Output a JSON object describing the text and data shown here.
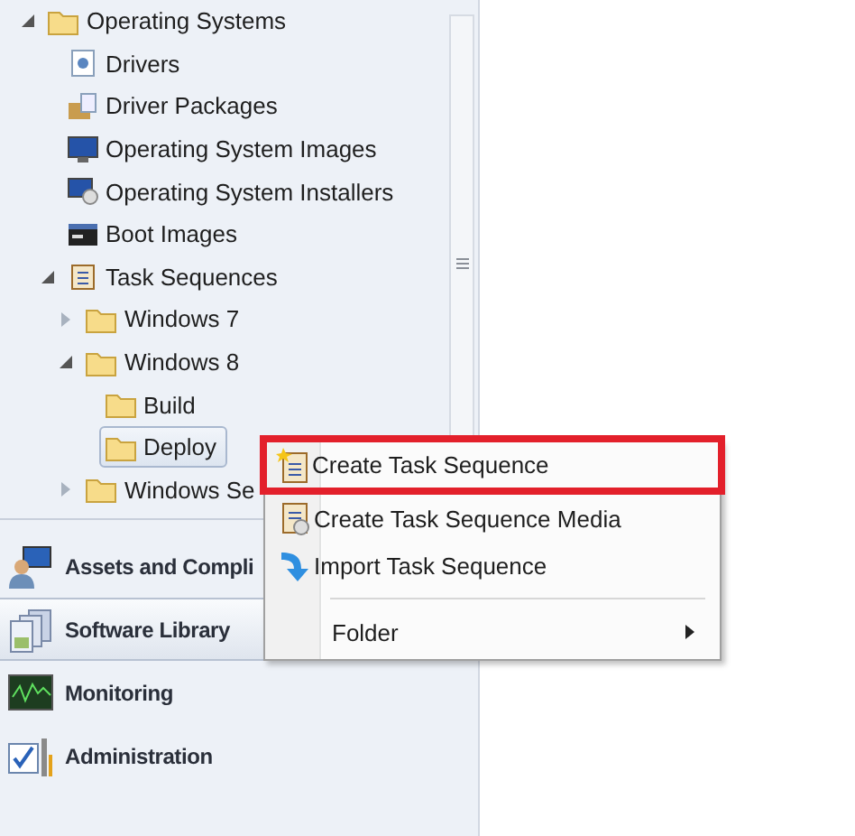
{
  "navigation_tree": [
    {
      "label": "Operating Systems",
      "kind": "folder",
      "expanded": true,
      "selected": false,
      "children": [
        {
          "label": "Drivers",
          "kind": "driver",
          "selected": false
        },
        {
          "label": "Driver Packages",
          "kind": "package",
          "selected": false
        },
        {
          "label": "Operating System Images",
          "kind": "os-image",
          "selected": false
        },
        {
          "label": "Operating System Installers",
          "kind": "installer",
          "selected": false
        },
        {
          "label": "Boot Images",
          "kind": "boot",
          "selected": false
        },
        {
          "label": "Task Sequences",
          "kind": "task-sequence",
          "expanded": true,
          "selected": false,
          "children": [
            {
              "label": "Windows 7",
              "kind": "folder",
              "expanded": false,
              "selected": false
            },
            {
              "label": "Windows 8",
              "kind": "folder",
              "expanded": true,
              "selected": false,
              "children": [
                {
                  "label": "Build",
                  "kind": "folder",
                  "selected": false
                },
                {
                  "label": "Deploy",
                  "kind": "folder",
                  "selected": true
                }
              ]
            },
            {
              "label": "Windows Se",
              "kind": "folder",
              "expanded": false,
              "selected": false
            }
          ]
        }
      ]
    }
  ],
  "workspaces": [
    {
      "label": "Assets and Compli",
      "kind": "assets",
      "selected": false
    },
    {
      "label": "Software Library",
      "kind": "library",
      "selected": true
    },
    {
      "label": "Monitoring",
      "kind": "monitoring",
      "selected": false
    },
    {
      "label": "Administration",
      "kind": "administration",
      "selected": false
    }
  ],
  "context_menu": [
    {
      "kind": "item",
      "label": "Create Task Sequence",
      "annotated": true
    },
    {
      "kind": "item",
      "label": "Create Task Sequence Media",
      "annotated": false
    },
    {
      "kind": "item",
      "label": "Import Task Sequence",
      "annotated": false
    },
    {
      "kind": "separator"
    },
    {
      "kind": "submenu",
      "label": "Folder"
    }
  ]
}
